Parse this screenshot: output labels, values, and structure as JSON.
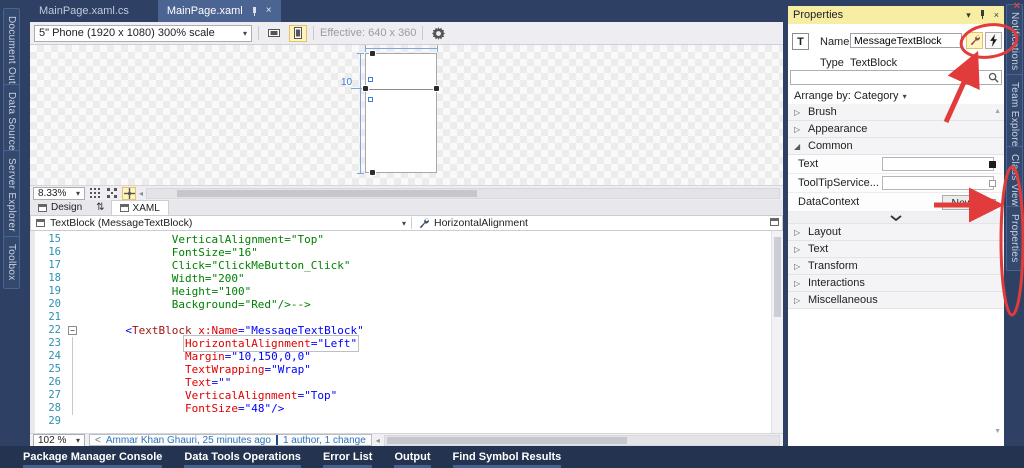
{
  "window": {
    "close_glyph": "×"
  },
  "left_tabs": [
    "Document Outline",
    "Data Sources",
    "Server Explorer",
    "Toolbox"
  ],
  "doc_tabs": {
    "inactive": "MainPage.xaml.cs",
    "active": "MainPage.xaml"
  },
  "designer": {
    "device": "5\" Phone (1920 x 1080) 300% scale",
    "effective": "Effective: 640 x 360",
    "margin_label": "10",
    "zoom": "8.33%"
  },
  "split": {
    "design": "Design",
    "xaml": "XAML",
    "swap_glyph": "⇅"
  },
  "breadcrumb": {
    "element": "TextBlock (MessageTextBlock)",
    "property": "HorizontalAlignment"
  },
  "code": {
    "zoom": "102 %",
    "codelens": {
      "back": "<",
      "author": "Ammar Khan Ghauri, 25 minutes ago",
      "changes": "1 author, 1 change"
    },
    "lines": [
      {
        "n": "15",
        "ind": 14,
        "segs": [
          [
            "cm",
            "VerticalAlignment=\"Top\""
          ]
        ]
      },
      {
        "n": "16",
        "ind": 14,
        "segs": [
          [
            "cm",
            "FontSize=\"16\""
          ]
        ]
      },
      {
        "n": "17",
        "ind": 14,
        "segs": [
          [
            "cm",
            "Click=\"ClickMeButton_Click\""
          ]
        ]
      },
      {
        "n": "18",
        "ind": 14,
        "segs": [
          [
            "cm",
            "Width=\"200\""
          ]
        ]
      },
      {
        "n": "19",
        "ind": 14,
        "segs": [
          [
            "cm",
            "Height=\"100\""
          ]
        ]
      },
      {
        "n": "20",
        "ind": 14,
        "segs": [
          [
            "cm",
            "Background=\"Red\"/>-->"
          ]
        ]
      },
      {
        "n": "21",
        "ind": 0,
        "segs": []
      },
      {
        "n": "22",
        "ind": 7,
        "fold": true,
        "segs": [
          [
            "pu",
            "<"
          ],
          [
            "el",
            "TextBlock"
          ],
          [
            "tx",
            " "
          ],
          [
            "at",
            "x:Name"
          ],
          [
            "pu",
            "="
          ],
          [
            "va",
            "\"MessageTextBlock\""
          ]
        ]
      },
      {
        "n": "23",
        "ind": 16,
        "hl": true,
        "vline": true,
        "segs": [
          [
            "at",
            "HorizontalAlignment"
          ],
          [
            "pu",
            "="
          ],
          [
            "va",
            "\"Left\""
          ]
        ]
      },
      {
        "n": "24",
        "ind": 16,
        "vline": true,
        "segs": [
          [
            "at",
            "Margin"
          ],
          [
            "pu",
            "="
          ],
          [
            "va",
            "\"10,150,0,0\""
          ]
        ]
      },
      {
        "n": "25",
        "ind": 16,
        "vline": true,
        "segs": [
          [
            "at",
            "TextWrapping"
          ],
          [
            "pu",
            "="
          ],
          [
            "va",
            "\"Wrap\""
          ]
        ]
      },
      {
        "n": "26",
        "ind": 16,
        "vline": true,
        "segs": [
          [
            "at",
            "Text"
          ],
          [
            "pu",
            "="
          ],
          [
            "va",
            "\"\""
          ]
        ]
      },
      {
        "n": "27",
        "ind": 16,
        "vline": true,
        "segs": [
          [
            "at",
            "VerticalAlignment"
          ],
          [
            "pu",
            "="
          ],
          [
            "va",
            "\"Top\""
          ]
        ]
      },
      {
        "n": "28",
        "ind": 16,
        "vline": true,
        "segs": [
          [
            "at",
            "FontSize"
          ],
          [
            "pu",
            "="
          ],
          [
            "va",
            "\"48\""
          ],
          [
            "pu",
            "/>"
          ]
        ]
      },
      {
        "n": "29",
        "ind": 0,
        "segs": []
      }
    ]
  },
  "properties": {
    "title": "Properties",
    "type_icon": "T",
    "name_label": "Name",
    "name_value": "MessageTextBlock",
    "type_label": "Type",
    "type_value": "TextBlock",
    "search_value": "",
    "arrange_label": "Arrange by: Category",
    "groups_top": [
      "Brush",
      "Appearance"
    ],
    "common_group": "Common",
    "common_rows": [
      {
        "label": "Text",
        "value": "",
        "marker": "filled",
        "kind": "input"
      },
      {
        "label": "ToolTipService...",
        "value": "",
        "marker": "empty",
        "kind": "input"
      },
      {
        "label": "DataContext",
        "button": "New",
        "marker": "empty",
        "kind": "button"
      }
    ],
    "groups_bottom": [
      "Layout",
      "Text",
      "Transform",
      "Interactions",
      "Miscellaneous"
    ]
  },
  "right_tabs": [
    "Notifications",
    "Team Explorer",
    "Class View",
    "Properties"
  ],
  "status_items": [
    "Package Manager Console",
    "Data Tools Operations",
    "Error List",
    "Output",
    "Find Symbol Results"
  ],
  "colors": {
    "annotation": "#E23B3B",
    "selection_yellow": "#FDF4BF",
    "title_yellow": "#F7EEA4",
    "accent_blue": "#4C6492"
  }
}
